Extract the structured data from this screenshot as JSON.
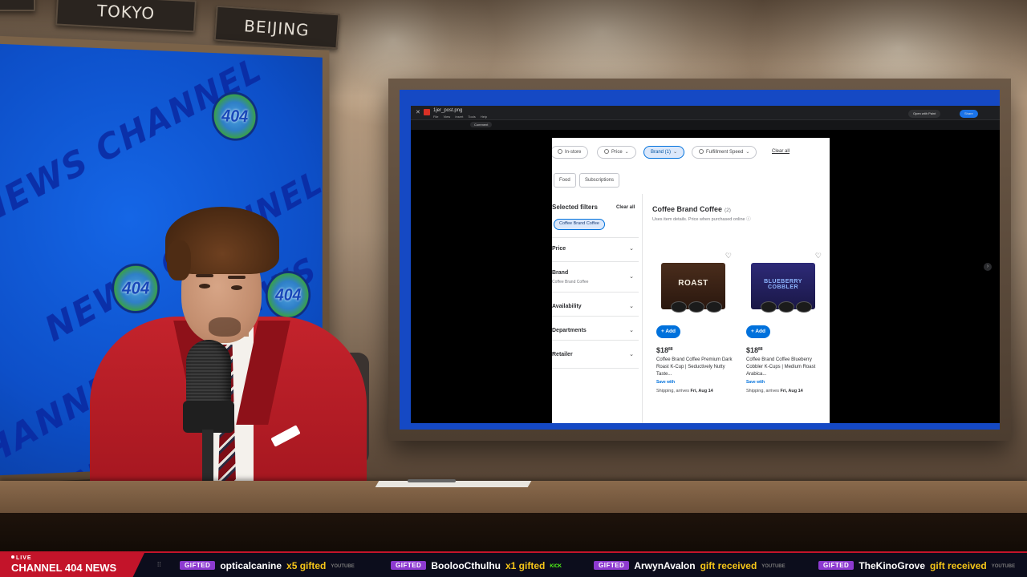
{
  "studio": {
    "clock_labels": [
      "TOKYO",
      "BEIJING"
    ]
  },
  "wall_screen": {
    "watermark_lines": [
      "NEWS CHANNEL",
      "NEWS CHANNEL 404",
      "CHANNEL 404 NEWS",
      "CHANNEL 404"
    ],
    "logo_text": "404"
  },
  "app_window": {
    "title": "1jer_post.png",
    "menu": [
      "File",
      "View",
      "Insert",
      "Tools",
      "Help"
    ],
    "open_with": "Open with Paint",
    "share": "Share",
    "comment": "Comment"
  },
  "shop": {
    "filter_chips": [
      {
        "label": "In-store",
        "active": false
      },
      {
        "label": "Price",
        "active": false
      },
      {
        "label": "Brand (1)",
        "active": true
      },
      {
        "label": "Fulfillment Speed",
        "active": false
      }
    ],
    "clear_all_top": "Clear all",
    "category_chips": [
      "Food",
      "Subscriptions"
    ],
    "selected_filters_title": "Selected filters",
    "selected_clear_all": "Clear all",
    "selected_chip": "Coffee Brand Coffee",
    "facets": [
      {
        "label": "Price",
        "sub": ""
      },
      {
        "label": "Brand",
        "sub": "Coffee Brand Coffee"
      },
      {
        "label": "Availability",
        "sub": ""
      },
      {
        "label": "Departments",
        "sub": ""
      },
      {
        "label": "Retailer",
        "sub": ""
      }
    ],
    "results_title": "Coffee Brand Coffee",
    "results_count": "(2)",
    "results_sub": "Uses item details. Price when purchased online",
    "products": [
      {
        "pack_text": "ROAST",
        "pack_color": "#3b2418",
        "add_label": "+ Add",
        "price_dollars": "$18",
        "price_cents": "88",
        "name": "Coffee Brand Coffee Premium Dark Roast K-Cup | Seductively Nutty Taste...",
        "save": "Save with",
        "ship_prefix": "Shipping, arrives",
        "ship_date": "Fri, Aug 14"
      },
      {
        "pack_text": "BLUEBERRY COBBLER",
        "pack_color": "#24205a",
        "add_label": "+ Add",
        "price_dollars": "$18",
        "price_cents": "88",
        "name": "Coffee Brand Coffee Blueberry Cobbler K-Cups | Medium Roast Arabica...",
        "save": "Save with",
        "ship_prefix": "Shipping, arrives",
        "ship_date": "Fri, Aug 14"
      }
    ]
  },
  "ticker": {
    "live": "LIVE",
    "brand": "CHANNEL 404 NEWS",
    "items": [
      {
        "badge": "GIFTED",
        "user": "opticalcanine",
        "msg": "x5 gifted",
        "platform": "YOUTUBE"
      },
      {
        "badge": "GIFTED",
        "user": "BoolooCthulhu",
        "msg": "x1 gifted",
        "platform": "KICK"
      },
      {
        "badge": "GIFTED",
        "user": "ArwynAvalon",
        "msg": "gift received",
        "platform": "YOUTUBE"
      },
      {
        "badge": "GIFTED",
        "user": "TheKinoGrove",
        "msg": "gift received",
        "platform": "YOUTUBE"
      }
    ]
  },
  "colors": {
    "ticker_red": "#c3142a",
    "gift_purple": "#8d3ad0",
    "gift_yellow": "#f5c518",
    "shop_blue": "#0071dc",
    "wall_blue": "#0d4fc8"
  }
}
